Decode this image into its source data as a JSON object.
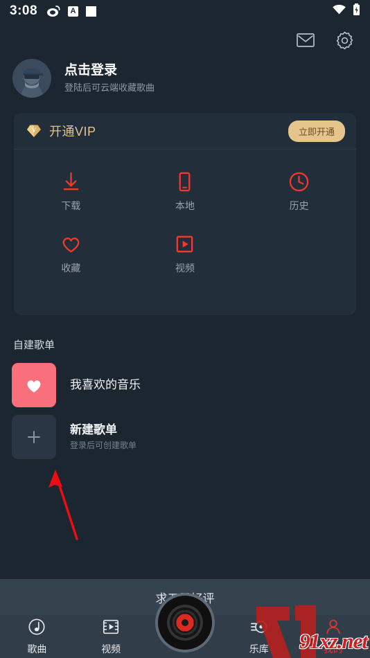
{
  "statusbar": {
    "time": "3:08",
    "icons": [
      "weibo-icon",
      "boxed-a-icon",
      "white-square-icon"
    ],
    "right_icons": [
      "wifi-icon",
      "battery-charging-icon"
    ]
  },
  "topbar": {
    "mail_icon": "mail-icon",
    "settings_icon": "gear-icon"
  },
  "profile": {
    "title": "点击登录",
    "subtitle": "登陆后可云端收藏歌曲",
    "avatar_icon": "avatar-bearded-sunglasses"
  },
  "vip": {
    "badge_letter": "V",
    "label": "开通VIP",
    "button_label": "立即开通",
    "accent_color": "#e4c38b",
    "button_bg": "#e6c58d"
  },
  "quick_actions": {
    "accent_color": "#f4392c",
    "items": [
      {
        "label": "下载",
        "icon": "download-icon"
      },
      {
        "label": "本地",
        "icon": "phone-icon"
      },
      {
        "label": "历史",
        "icon": "clock-icon"
      },
      {
        "label": "收藏",
        "icon": "heart-outline-icon"
      },
      {
        "label": "视频",
        "icon": "video-play-icon"
      }
    ]
  },
  "playlists": {
    "section_title": "自建歌单",
    "items": [
      {
        "name": "我喜欢的音乐",
        "subtitle": "",
        "icon": "heart-filled-icon",
        "tile_color": "#f9707c"
      },
      {
        "name": "新建歌单",
        "subtitle": "登录后可创建歌单",
        "icon": "plus-icon",
        "tile_color": "#2a3644"
      }
    ]
  },
  "rate_banner": {
    "text": "求五星好评"
  },
  "bottom_nav": {
    "items": [
      {
        "label": "歌曲",
        "icon": "music-note-disc-icon"
      },
      {
        "label": "视频",
        "icon": "video-film-icon"
      },
      {
        "label": "乐库",
        "icon": "library-icon"
      },
      {
        "label": "我的",
        "icon": "user-icon"
      }
    ],
    "center_button": "vinyl-record-play-button"
  },
  "watermark": {
    "text": "91xz.net"
  }
}
